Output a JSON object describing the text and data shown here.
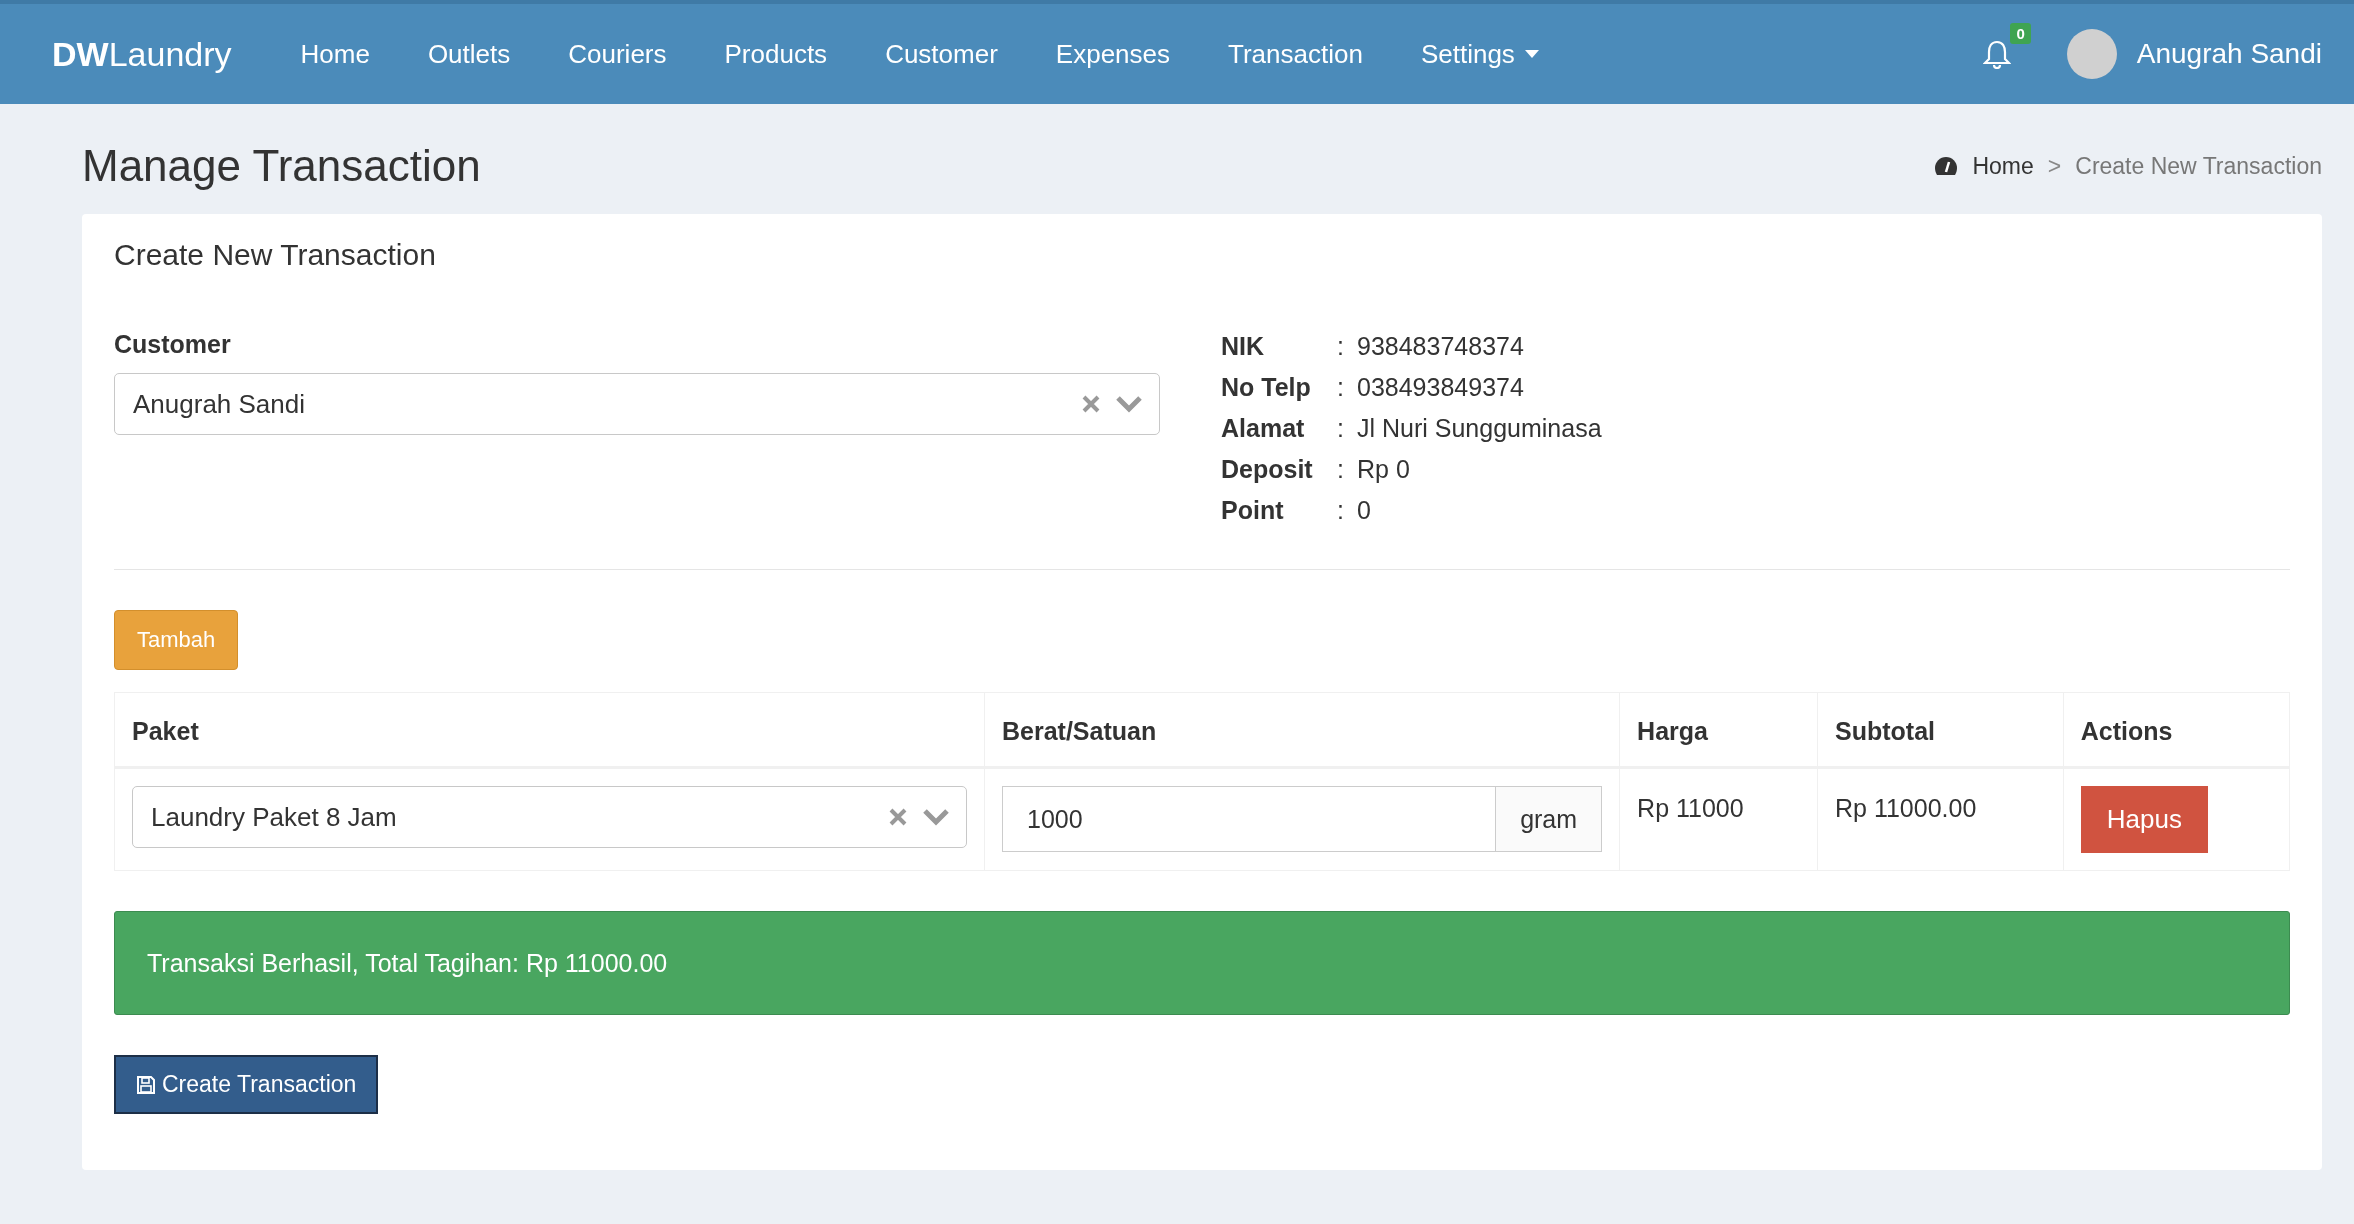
{
  "navbar": {
    "brand": "**DW**Laundry",
    "menu": [
      {
        "label": "Home",
        "dropdown": false
      },
      {
        "label": "Outlets",
        "dropdown": false
      },
      {
        "label": "Couriers",
        "dropdown": false
      },
      {
        "label": "Products",
        "dropdown": false
      },
      {
        "label": "Customer",
        "dropdown": false
      },
      {
        "label": "Expenses",
        "dropdown": false
      },
      {
        "label": "Transaction",
        "dropdown": false
      },
      {
        "label": "Settings",
        "dropdown": true
      }
    ],
    "notification_count": "0",
    "user_name": "Anugrah Sandi"
  },
  "page_title": "Manage Transaction",
  "breadcrumb": {
    "items": [
      {
        "label": "Home",
        "selected": false
      },
      {
        "label": "Create New Transaction",
        "selected": true
      }
    ],
    "separator": ">"
  },
  "card": {
    "title": "Create New Transaction",
    "customer": {
      "label": "Customer",
      "value": "Anugrah Sandi"
    },
    "customer_info": [
      {
        "label": "NIK",
        "separator": ":",
        "value": "938483748374"
      },
      {
        "label": "No Telp",
        "separator": ":",
        "value": "038493849374"
      },
      {
        "label": "Alamat",
        "separator": ":",
        "value": "Jl Nuri Sungguminasa"
      },
      {
        "label": "Deposit",
        "separator": ":",
        "value": "Rp 0"
      },
      {
        "label": "Point",
        "separator": ":",
        "value": "0"
      }
    ],
    "add_button": "Tambah",
    "table": {
      "columns": [
        "Paket",
        "Berat/Satuan",
        "Harga",
        "Subtotal",
        "Actions"
      ],
      "rows": [
        {
          "paket": "Laundry Paket 8 Jam",
          "berat": "1000",
          "unit": "gram",
          "harga": "Rp 11000",
          "subtotal": "Rp 11000.00",
          "action": "Hapus"
        }
      ]
    },
    "alert": {
      "text": "Transaksi Berhasil, Total Tagihan: Rp 11000.00"
    },
    "submit_button": "Create Transaction"
  }
}
